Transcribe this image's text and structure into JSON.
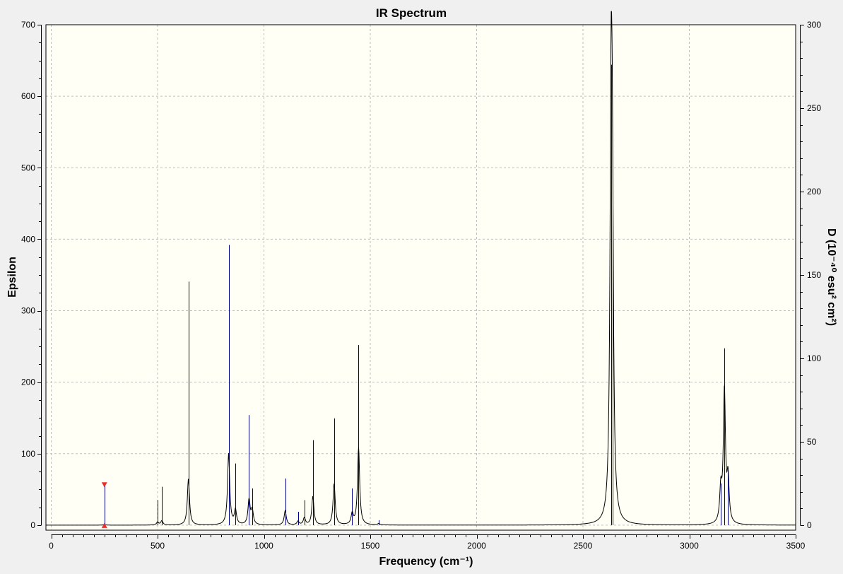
{
  "window": {
    "background": "#f0f0f0"
  },
  "chart_data": {
    "type": "line",
    "title": "IR Spectrum",
    "xlabel": "Frequency (cm⁻¹)",
    "ylabel": "Epsilon",
    "y2label": "D (10⁻⁴⁰ esu² cm²)",
    "xlim": [
      0,
      3500
    ],
    "xlim_plot": [
      -25,
      3500
    ],
    "ylim": [
      0,
      700
    ],
    "ylim_plot": [
      -7,
      700
    ],
    "y2lim": [
      0,
      300
    ],
    "x_ticks": [
      0,
      500,
      1000,
      1500,
      2000,
      2500,
      3000,
      3500
    ],
    "x_tick_labels": [
      "0",
      "500",
      "1000",
      "1500",
      "2000",
      "2500",
      "3000",
      "3500"
    ],
    "y_ticks": [
      0,
      100,
      200,
      300,
      400,
      500,
      600,
      700
    ],
    "y_tick_labels": [
      "0",
      "100",
      "200",
      "300",
      "400",
      "500",
      "600",
      "700"
    ],
    "y2_ticks": [
      0,
      50,
      100,
      150,
      200,
      250,
      300
    ],
    "y2_tick_labels": [
      "0",
      "50",
      "100",
      "150",
      "200",
      "250",
      "300"
    ],
    "grid": true,
    "legend": "none",
    "colors": {
      "plot_background": "#fffff5",
      "spectrum": "#000000",
      "stick": "#00008b",
      "grid": "#bfbfbf",
      "marker": "#e8302c",
      "axis": "#000000"
    },
    "peak_width": 6,
    "peaks": [
      {
        "x": 250,
        "epsilon": 1
      },
      {
        "x": 500,
        "epsilon": 4
      },
      {
        "x": 520,
        "epsilon": 6
      },
      {
        "x": 645,
        "epsilon": 65
      },
      {
        "x": 834,
        "epsilon": 100
      },
      {
        "x": 866,
        "epsilon": 20
      },
      {
        "x": 930,
        "epsilon": 35
      },
      {
        "x": 945,
        "epsilon": 20
      },
      {
        "x": 1100,
        "epsilon": 20
      },
      {
        "x": 1160,
        "epsilon": 5
      },
      {
        "x": 1190,
        "epsilon": 10
      },
      {
        "x": 1230,
        "epsilon": 40
      },
      {
        "x": 1330,
        "epsilon": 58
      },
      {
        "x": 1415,
        "epsilon": 15
      },
      {
        "x": 1445,
        "epsilon": 108
      },
      {
        "x": 1540,
        "epsilon": 2
      },
      {
        "x": 2632,
        "epsilon": 510
      },
      {
        "x": 2638,
        "epsilon": 380
      },
      {
        "x": 3148,
        "epsilon": 45
      },
      {
        "x": 3165,
        "epsilon": 185
      },
      {
        "x": 3182,
        "epsilon": 60
      }
    ],
    "sticks": [
      {
        "x": 250,
        "d": 24
      },
      {
        "x": 500,
        "d": 15
      },
      {
        "x": 520,
        "d": 23
      },
      {
        "x": 645,
        "d": 146
      },
      {
        "x": 834,
        "d": 168
      },
      {
        "x": 866,
        "d": 37
      },
      {
        "x": 930,
        "d": 66
      },
      {
        "x": 945,
        "d": 22
      },
      {
        "x": 1100,
        "d": 28
      },
      {
        "x": 1160,
        "d": 8
      },
      {
        "x": 1190,
        "d": 15
      },
      {
        "x": 1230,
        "d": 51
      },
      {
        "x": 1330,
        "d": 64
      },
      {
        "x": 1415,
        "d": 22
      },
      {
        "x": 1445,
        "d": 108
      },
      {
        "x": 1540,
        "d": 3
      },
      {
        "x": 2632,
        "d": 276
      },
      {
        "x": 2638,
        "d": 191
      },
      {
        "x": 3148,
        "d": 25
      },
      {
        "x": 3165,
        "d": 106
      },
      {
        "x": 3182,
        "d": 33
      }
    ],
    "markers": [
      {
        "x": 250,
        "position": "top"
      },
      {
        "x": 250,
        "position": "bottom"
      }
    ]
  }
}
